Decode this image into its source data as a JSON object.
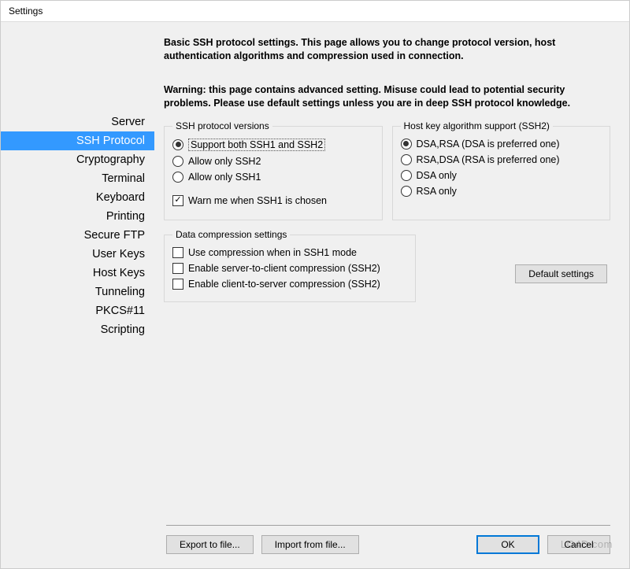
{
  "window": {
    "title": "Settings"
  },
  "sidebar": {
    "items": [
      {
        "label": "Server"
      },
      {
        "label": "SSH Protocol"
      },
      {
        "label": "Cryptography"
      },
      {
        "label": "Terminal"
      },
      {
        "label": "Keyboard"
      },
      {
        "label": "Printing"
      },
      {
        "label": "Secure FTP"
      },
      {
        "label": "User Keys"
      },
      {
        "label": "Host Keys"
      },
      {
        "label": "Tunneling"
      },
      {
        "label": "PKCS#11"
      },
      {
        "label": "Scripting"
      }
    ],
    "selected_index": 1
  },
  "main": {
    "description": "Basic SSH protocol settings. This page allows you to change protocol version, host authentication algorithms and compression used in connection.",
    "warning": "Warning: this page contains advanced setting. Misuse could lead to potential security problems. Please use default settings unless you are in deep SSH protocol knowledge."
  },
  "group_versions": {
    "title": "SSH protocol versions",
    "options": [
      "Support both SSH1 and SSH2",
      "Allow only SSH2",
      "Allow only SSH1"
    ],
    "selected": 0,
    "warn_label": "Warn me when SSH1 is chosen",
    "warn_checked": true
  },
  "group_hostkey": {
    "title": "Host key algorithm support (SSH2)",
    "options": [
      "DSA,RSA (DSA is preferred one)",
      "RSA,DSA (RSA is preferred one)",
      "DSA only",
      "RSA only"
    ],
    "selected": 0
  },
  "group_compression": {
    "title": "Data compression settings",
    "options": [
      "Use compression when in SSH1 mode",
      "Enable server-to-client compression (SSH2)",
      "Enable client-to-server compression (SSH2)"
    ],
    "checked": [
      false,
      false,
      false
    ]
  },
  "buttons": {
    "defaults": "Default settings",
    "export": "Export to file...",
    "import": "Import from file...",
    "ok": "OK",
    "cancel": "Cancel"
  },
  "watermark": "LO4D.com"
}
